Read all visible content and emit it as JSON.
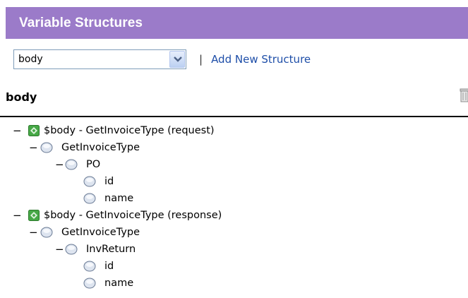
{
  "header": {
    "title": "Variable Structures"
  },
  "toolbar": {
    "select_value": "body",
    "separator": "|",
    "add_link": "Add New Structure"
  },
  "section": {
    "title": "body"
  },
  "tree": {
    "request_root": "$body - GetInvoiceType (request)",
    "request_type": "GetInvoiceType",
    "request_po": "PO",
    "request_id": "id",
    "request_name": "name",
    "response_root": "$body - GetInvoiceType (response)",
    "response_type": "GetInvoiceType",
    "response_inv": "InvReturn",
    "response_id": "id",
    "response_name": "name"
  },
  "colors": {
    "header_bg": "#9b7bc9",
    "link": "#1e4ea8",
    "node_green": "#3aa03a"
  }
}
